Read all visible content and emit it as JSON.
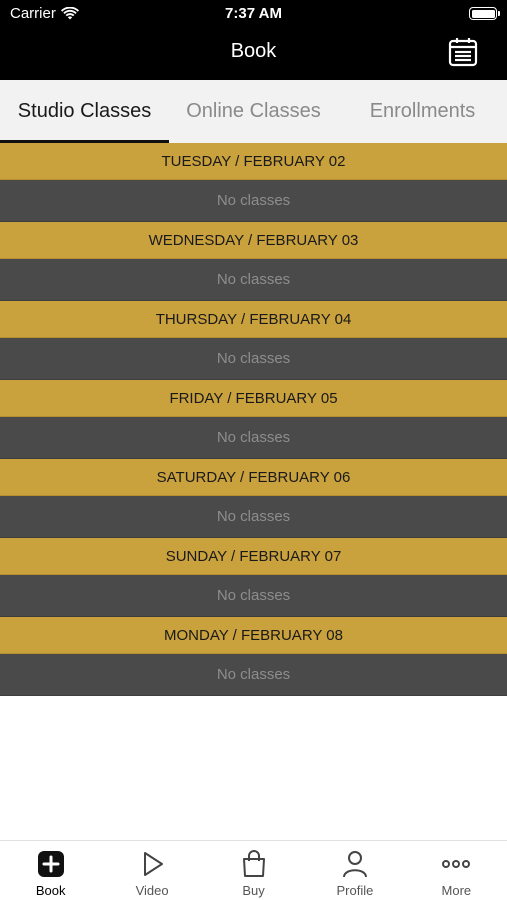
{
  "status_bar": {
    "carrier": "Carrier",
    "time": "7:37 AM",
    "battery_level": 1.0
  },
  "nav": {
    "title": "Book",
    "calendar_icon": "calendar-icon"
  },
  "tabs": [
    {
      "label": "Studio Classes",
      "active": true
    },
    {
      "label": "Online Classes",
      "active": false
    },
    {
      "label": "Enrollments",
      "active": false
    }
  ],
  "schedule": [
    {
      "day": "TUESDAY / FEBRUARY 02",
      "status": "No classes"
    },
    {
      "day": "WEDNESDAY / FEBRUARY 03",
      "status": "No classes"
    },
    {
      "day": "THURSDAY / FEBRUARY 04",
      "status": "No classes"
    },
    {
      "day": "FRIDAY / FEBRUARY 05",
      "status": "No classes"
    },
    {
      "day": "SATURDAY / FEBRUARY 06",
      "status": "No classes"
    },
    {
      "day": "SUNDAY / FEBRUARY 07",
      "status": "No classes"
    },
    {
      "day": "MONDAY / FEBRUARY 08",
      "status": "No classes"
    }
  ],
  "tabbar": [
    {
      "label": "Book",
      "icon": "plus-square-icon",
      "active": true
    },
    {
      "label": "Video",
      "icon": "play-icon",
      "active": false
    },
    {
      "label": "Buy",
      "icon": "shopping-bag-icon",
      "active": false
    },
    {
      "label": "Profile",
      "icon": "person-icon",
      "active": false
    },
    {
      "label": "More",
      "icon": "more-dots-icon",
      "active": false
    }
  ],
  "colors": {
    "header_bg": "#000000",
    "day_header": "#c9a13d",
    "empty_row": "#4a4a4a",
    "tab_bg": "#f2f2f2"
  }
}
